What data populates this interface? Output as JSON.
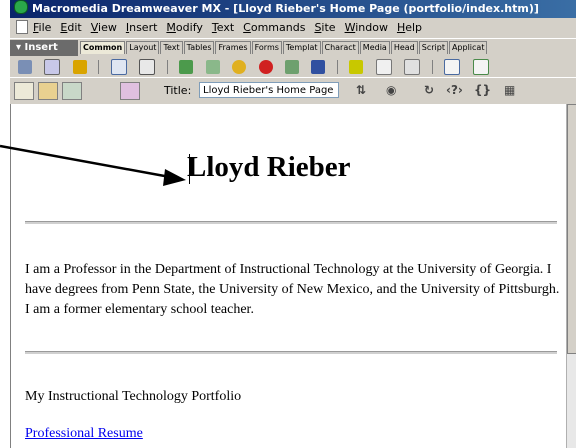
{
  "window": {
    "title": "Macromedia Dreamweaver MX - [Lloyd Rieber's Home Page (portfolio/index.htm)]"
  },
  "menu": [
    {
      "key": "F",
      "rest": "ile"
    },
    {
      "key": "E",
      "rest": "dit"
    },
    {
      "key": "V",
      "rest": "iew"
    },
    {
      "key": "I",
      "rest": "nsert"
    },
    {
      "key": "M",
      "rest": "odify"
    },
    {
      "key": "T",
      "rest": "ext"
    },
    {
      "key": "C",
      "rest": "ommands"
    },
    {
      "key": "S",
      "rest": "ite"
    },
    {
      "key": "W",
      "rest": "indow"
    },
    {
      "key": "H",
      "rest": "elp"
    }
  ],
  "insert_bar": {
    "title": "▾ Insert",
    "tabs": [
      "Common",
      "Layout",
      "Text",
      "Tables",
      "Frames",
      "Forms",
      "Templat",
      "Charact",
      "Media",
      "Head",
      "Script",
      "Applicat"
    ]
  },
  "doc_toolbar": {
    "title_label": "Title:",
    "title_value": "Lloyd Rieber's Home Page"
  },
  "page": {
    "heading": "Lloyd Rieber",
    "intro": "I am a Professor in the Department of Instructional Technology at the University of Georgia. I have degrees from Penn State, the University of New Mexico, and the University of Pittsburgh. I am a former elementary school teacher.",
    "portfolio_label": "My Instructional Technology Portfolio",
    "resume_link": "Professional Resume"
  },
  "colors": {
    "title_bar": "#0a246a",
    "chrome": "#d4d0c8",
    "link": "#0000ee"
  }
}
